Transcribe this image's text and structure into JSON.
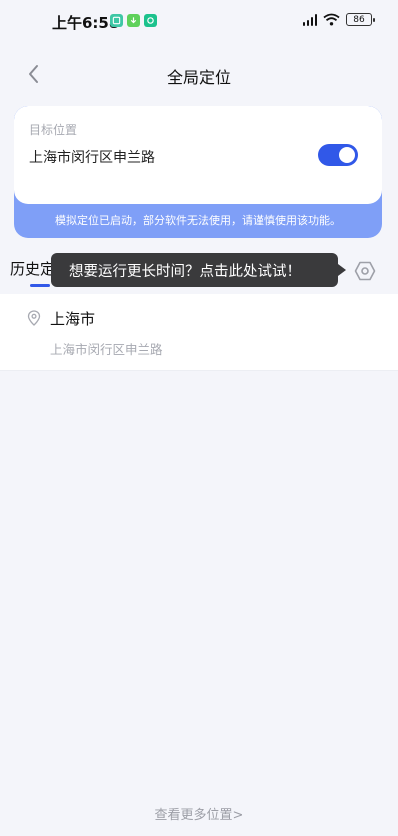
{
  "status_bar": {
    "time": "上午6:58",
    "battery": "86",
    "app_icons": [
      {
        "name": "gallery-app-icon",
        "color": "#3ec7a5"
      },
      {
        "name": "download-app-icon",
        "color": "#5fd15a"
      },
      {
        "name": "wechat-app-icon",
        "color": "#1cc28d"
      }
    ]
  },
  "header": {
    "title": "全局定位",
    "back_icon": "chevron-left-icon"
  },
  "target_card": {
    "label": "目标位置",
    "address": "上海市闵行区申兰路",
    "toggle_on": true,
    "warning": "模拟定位已启动，部分软件无法使用，请谨慎使用该功能。"
  },
  "history": {
    "tab_label": "历史定位",
    "tooltip": "想要运行更长时间？点击此处试试！",
    "settings_icon": "hexagon-settings-icon",
    "items": [
      {
        "city": "上海市",
        "address": "上海市闵行区申兰路",
        "icon": "location-pin-icon"
      }
    ],
    "more_label": "查看更多位置>"
  },
  "colors": {
    "accent": "#3158e8",
    "card_band": "#7f9ff7",
    "background": "#f4f5fa",
    "tooltip_bg": "#3a3a3c"
  }
}
